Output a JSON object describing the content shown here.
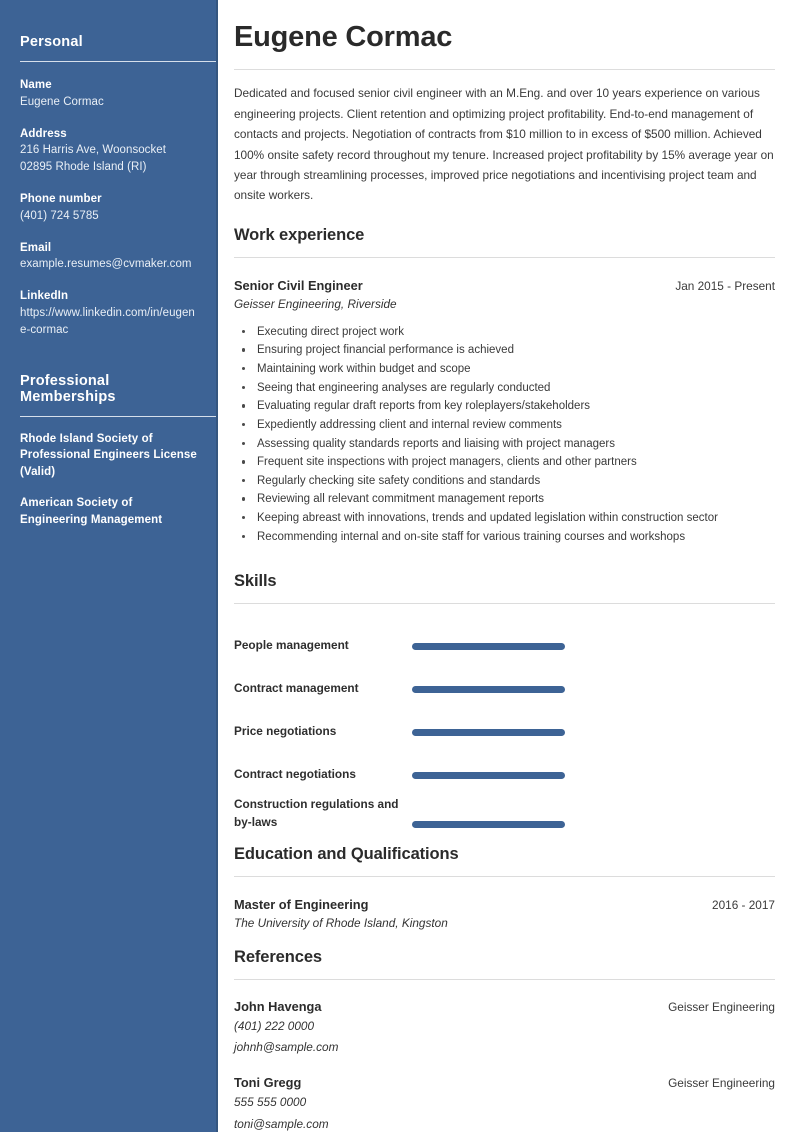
{
  "sidebar": {
    "personal": {
      "heading": "Personal",
      "fields": [
        {
          "label": "Name",
          "value": "Eugene Cormac"
        },
        {
          "label": "Address",
          "value": "216 Harris Ave, Woonsocket 02895 Rhode Island (RI)"
        },
        {
          "label": "Phone number",
          "value": "(401) 724 5785"
        },
        {
          "label": "Email",
          "value": "example.resumes@cvmaker.com"
        },
        {
          "label": "LinkedIn",
          "value": "https://www.linkedin.com/in/eugene-cormac"
        }
      ]
    },
    "memberships": {
      "heading": "Professional Memberships",
      "items": [
        "Rhode Island Society of Professional Engineers License (Valid)",
        "American Society of Engineering Management"
      ]
    },
    "background_color": "#3d6395",
    "text_color": "#ffffff"
  },
  "main": {
    "name": "Eugene Cormac",
    "summary": "Dedicated and focused senior civil engineer with an M.Eng. and over 10 years experience on various engineering projects. Client retention and optimizing project profitability. End-to-end management of contacts and projects. Negotiation of contracts from $10 million to in excess of $500 million. Achieved 100% onsite safety record throughout my tenure. Increased project profitability by 15% average year on year through streamlining processes, improved price negotiations and incentivising project team and onsite workers.",
    "work_experience": {
      "heading": "Work experience",
      "entries": [
        {
          "title": "Senior Civil Engineer",
          "date": "Jan 2015 - Present",
          "company": "Geisser Engineering, Riverside",
          "bullets": [
            "Executing direct project work",
            "Ensuring project financial performance is achieved",
            "Maintaining work within budget and scope",
            "Seeing that engineering analyses are regularly conducted",
            "Evaluating regular draft reports from key roleplayers/stakeholders",
            "Expediently addressing client and internal review comments",
            "Assessing quality standards reports and liaising with project managers",
            "Frequent site inspections with project managers, clients and other partners",
            "Regularly checking site safety conditions and standards",
            "Reviewing all relevant commitment management reports",
            "Keeping abreast with innovations, trends and updated legislation within construction sector",
            "Recommending internal and on-site staff for various training courses and workshops"
          ]
        }
      ]
    },
    "skills": {
      "heading": "Skills",
      "bar_color": "#3d6395",
      "items": [
        {
          "name": "People management",
          "level": 100
        },
        {
          "name": "Contract management",
          "level": 100
        },
        {
          "name": "Price negotiations",
          "level": 100
        },
        {
          "name": "Contract negotiations",
          "level": 100
        },
        {
          "name": "Construction regulations and by-laws",
          "level": 100
        }
      ]
    },
    "education": {
      "heading": "Education and Qualifications",
      "entries": [
        {
          "title": "Master of Engineering",
          "date": "2016 - 2017",
          "institution": "The University of Rhode Island, Kingston"
        }
      ]
    },
    "references": {
      "heading": "References",
      "entries": [
        {
          "name": "John Havenga",
          "company": "Geisser Engineering",
          "phone": "(401) 222 0000",
          "email": "johnh@sample.com"
        },
        {
          "name": "Toni Gregg",
          "company": "Geisser Engineering",
          "phone": "555 555 0000",
          "email": "toni@sample.com"
        }
      ]
    }
  }
}
